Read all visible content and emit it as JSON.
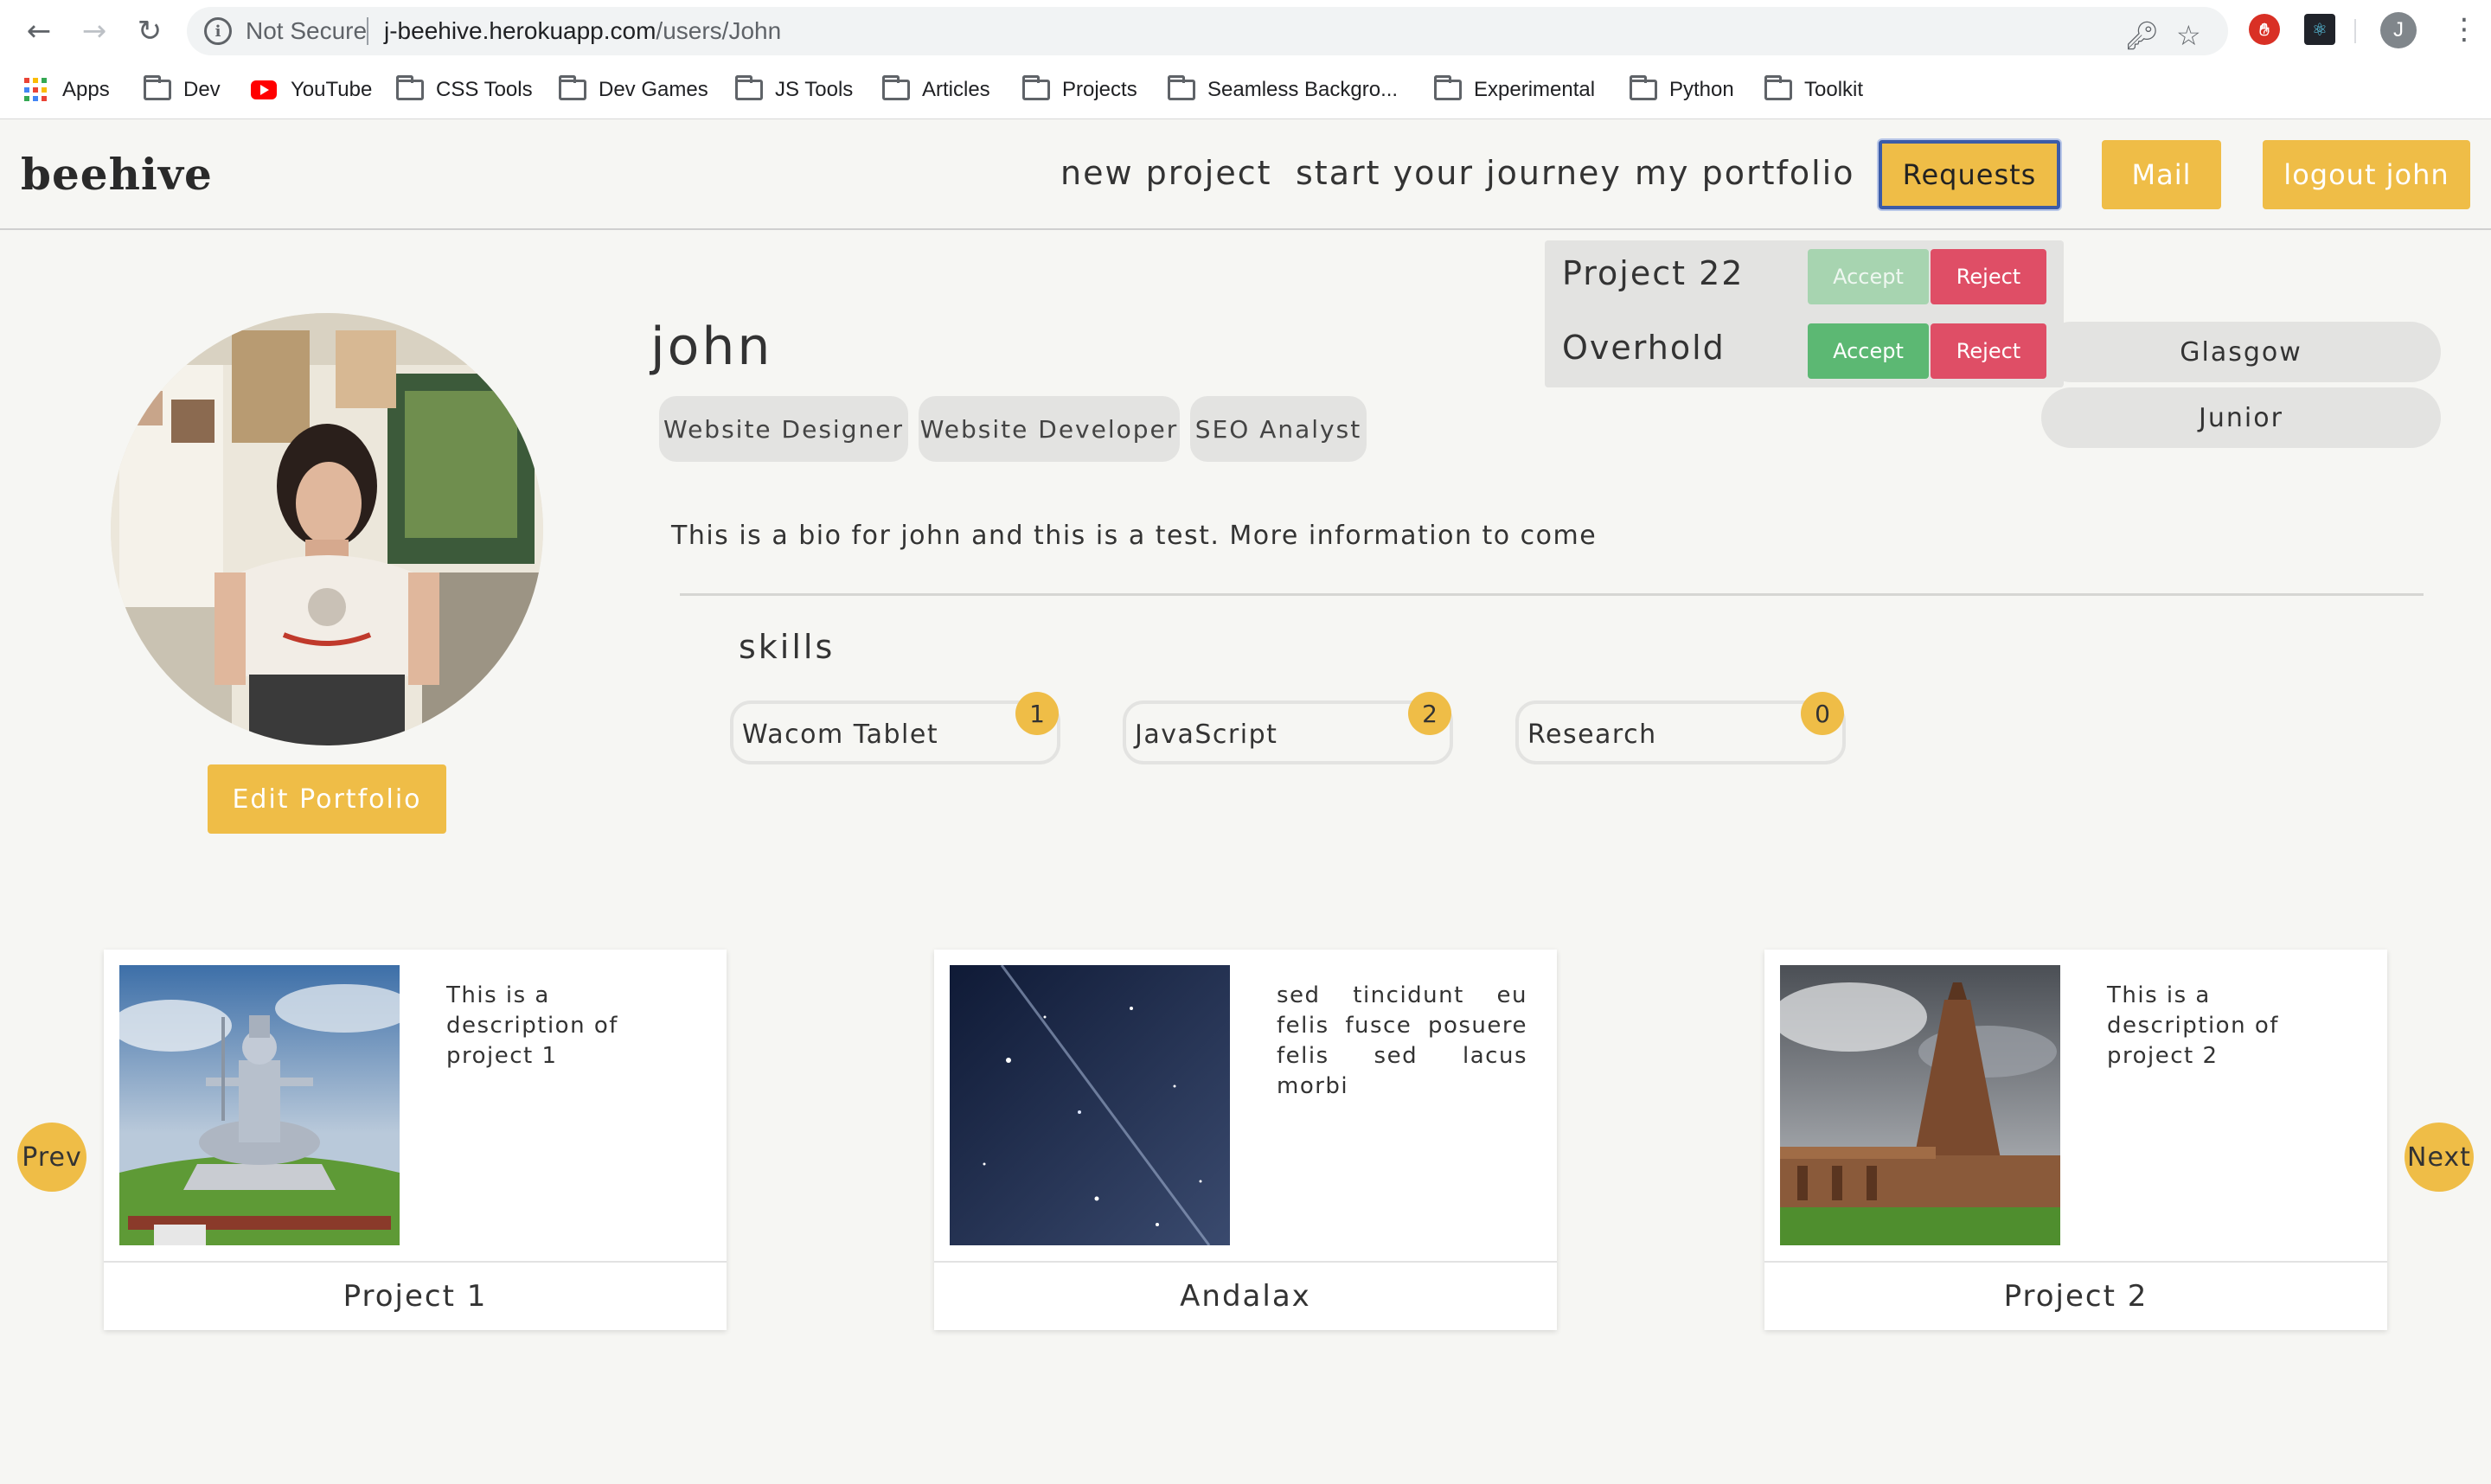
{
  "browser": {
    "security_label": "Not Secure",
    "url_host": "j-beehive.herokuapp.com",
    "url_path": "/users/John",
    "profile_initial": "J",
    "bookmarks": [
      "Apps",
      "Dev",
      "YouTube",
      "CSS Tools",
      "Dev Games",
      "JS Tools",
      "Articles",
      "Projects",
      "Seamless Backgro...",
      "Experimental",
      "Python",
      "Toolkit"
    ]
  },
  "header": {
    "logo": "beehive",
    "nav": [
      "new project",
      "start your journey",
      "my portfolio"
    ],
    "requests_label": "Requests",
    "mail_label": "Mail",
    "logout_label": "logout john"
  },
  "requests": [
    {
      "project": "Project 22",
      "accept": "Accept",
      "reject": "Reject",
      "accept_state": "faded"
    },
    {
      "project": "Overhold",
      "accept": "Accept",
      "reject": "Reject",
      "accept_state": "active"
    }
  ],
  "profile": {
    "username": "john",
    "roles": [
      "Website Designer",
      "Website Developer",
      "SEO Analyst"
    ],
    "location": "Glasgow",
    "level": "Junior",
    "bio": "This is a bio for john and this is a test. More information to come",
    "edit_label": "Edit Portfolio"
  },
  "skills": {
    "title": "skills",
    "items": [
      {
        "name": "Wacom Tablet",
        "count": "1"
      },
      {
        "name": "JavaScript",
        "count": "2"
      },
      {
        "name": "Research",
        "count": "0"
      }
    ]
  },
  "projects": {
    "prev_label": "Prev",
    "next_label": "Next",
    "items": [
      {
        "title": "Project 1",
        "description": "This is a description of project 1",
        "image": "statue-photo"
      },
      {
        "title": "Andalax",
        "description": "sed tincidunt eu felis fusce posuere felis sed lacus morbi",
        "image": "night-sky-photo"
      },
      {
        "title": "Project 2",
        "description": "This is a description of project 2",
        "image": "temple-photo"
      }
    ]
  },
  "colors": {
    "accent": "#efbd47",
    "accept": "#5cb873",
    "reject": "#df4e66",
    "pill": "#e3e3e1",
    "background": "#f6f6f3"
  }
}
